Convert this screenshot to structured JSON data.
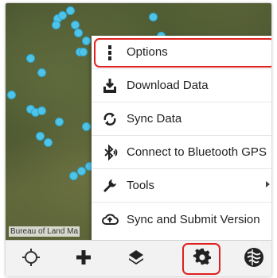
{
  "map": {
    "attribution": "Bureau of Land Ma",
    "point_color": "#4fc3e8"
  },
  "menu": {
    "items": [
      {
        "label": "Options",
        "icon": "vertical-dots-icon",
        "highlighted": true
      },
      {
        "label": "Download Data",
        "icon": "download-tray-icon"
      },
      {
        "label": "Sync Data",
        "icon": "sync-arrows-icon"
      },
      {
        "label": "Connect to Bluetooth GPS",
        "icon": "bluetooth-searching-icon"
      },
      {
        "label": "Tools",
        "icon": "wrench-icon",
        "has_submenu": true
      },
      {
        "label": "Sync and Submit Version",
        "icon": "cloud-upload-icon"
      }
    ]
  },
  "toolbar": {
    "buttons": [
      {
        "icon": "crosshair-location-icon"
      },
      {
        "icon": "plus-icon"
      },
      {
        "icon": "layers-icon"
      },
      {
        "icon": "gear-icon",
        "highlighted": true
      },
      {
        "icon": "globe-logo-icon"
      }
    ]
  },
  "highlight_color": "#e02020"
}
